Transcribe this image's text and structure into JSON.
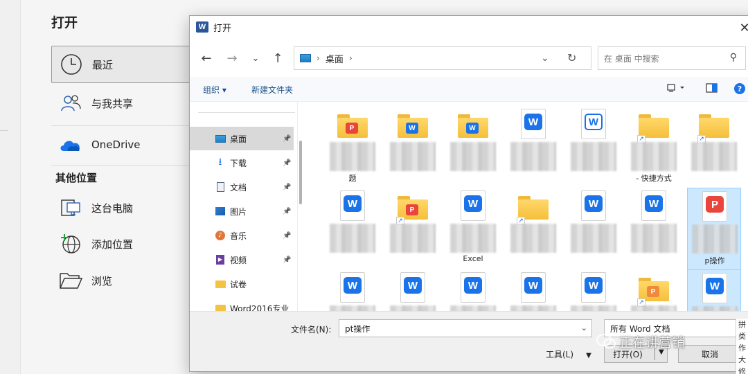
{
  "backstage": {
    "title": "打开",
    "items": [
      {
        "label": "最近",
        "icon": "clock-icon"
      },
      {
        "label": "与我共享",
        "icon": "people-icon"
      },
      {
        "label": "OneDrive",
        "icon": "cloud-icon"
      }
    ],
    "section_title": "其他位置",
    "locations": [
      {
        "label": "这台电脑",
        "icon": "computer-icon"
      },
      {
        "label": "添加位置",
        "icon": "globe-plus-icon"
      },
      {
        "label": "浏览",
        "icon": "folder-open-icon"
      }
    ]
  },
  "dialog": {
    "title": "打开",
    "address": {
      "location": "桌面"
    },
    "search_placeholder": "在 桌面 中搜索",
    "toolbar": {
      "organize": "组织 ▾",
      "new_folder": "新建文件夹"
    },
    "nav_items": [
      {
        "label": "桌面",
        "icon": "desktop-icon",
        "pinned": true,
        "selected": true
      },
      {
        "label": "下载",
        "icon": "download-icon",
        "pinned": true
      },
      {
        "label": "文档",
        "icon": "document-icon",
        "pinned": true
      },
      {
        "label": "图片",
        "icon": "pictures-icon",
        "pinned": true
      },
      {
        "label": "音乐",
        "icon": "music-icon",
        "pinned": true
      },
      {
        "label": "视频",
        "icon": "video-icon",
        "pinned": true
      },
      {
        "label": "试卷",
        "icon": "folder-icon",
        "pinned": false
      },
      {
        "label": "Word2016专业",
        "icon": "folder-icon",
        "pinned": false
      }
    ],
    "files": [
      {
        "type": "folder",
        "badge": "P",
        "badge_color": "#e8453c",
        "name": "题"
      },
      {
        "type": "folder",
        "badge": "W",
        "badge_color": "#1a73e8",
        "name": ""
      },
      {
        "type": "folder",
        "badge": "W",
        "badge_color": "#1a73e8",
        "name": ""
      },
      {
        "type": "word",
        "name": ""
      },
      {
        "type": "word-outline",
        "name": ""
      },
      {
        "type": "folder-shortcut",
        "name": "- 快捷方式"
      },
      {
        "type": "folder-shortcut",
        "name": ""
      },
      {
        "type": "word",
        "name": ""
      },
      {
        "type": "folder-shortcut",
        "badge": "P",
        "badge_color": "#e8453c",
        "name": ""
      },
      {
        "type": "word",
        "name": "Excel"
      },
      {
        "type": "folder-shortcut",
        "name": ""
      },
      {
        "type": "word",
        "name": ""
      },
      {
        "type": "word",
        "name": ""
      },
      {
        "type": "pdf",
        "name": "p操作",
        "highlighted": true
      },
      {
        "type": "word",
        "name": ""
      },
      {
        "type": "word",
        "name": ""
      },
      {
        "type": "word",
        "name": ""
      },
      {
        "type": "word",
        "name": ""
      },
      {
        "type": "word",
        "name": ""
      },
      {
        "type": "folder-shortcut",
        "badge": "P",
        "badge_color": "#f08a3a",
        "name": ""
      },
      {
        "type": "word",
        "name": "",
        "highlighted": true
      }
    ],
    "filename_label": "文件名(N):",
    "filename_value": "pt操作",
    "filetype": "所有 Word 文档",
    "tools_label": "工具(L)",
    "open_label": "打开(O)",
    "cancel_label": "取消"
  },
  "watermark": "正在讲营销",
  "edge_fragment": [
    "拼",
    "类",
    "作",
    "大",
    "修"
  ]
}
